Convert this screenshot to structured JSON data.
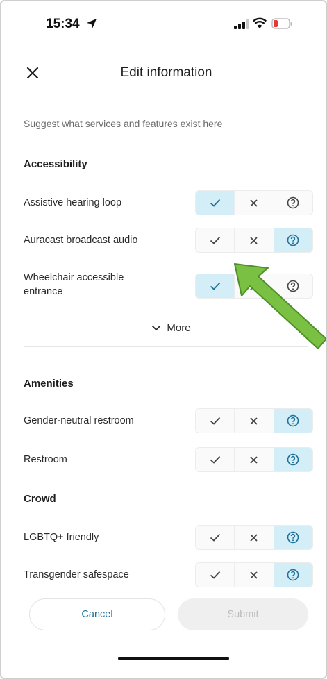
{
  "status_bar": {
    "time": "15:34"
  },
  "header": {
    "title": "Edit information"
  },
  "subtitle": "Suggest what services and features exist here",
  "sections": [
    {
      "title": "Accessibility",
      "items": [
        {
          "label": "Assistive hearing loop",
          "selected": "yes"
        },
        {
          "label": "Auracast broadcast audio",
          "selected": "unknown"
        },
        {
          "label": "Wheelchair accessible entrance",
          "selected": "yes"
        }
      ]
    },
    {
      "title": "Amenities",
      "items": [
        {
          "label": "Gender-neutral restroom",
          "selected": "unknown"
        },
        {
          "label": "Restroom",
          "selected": "unknown"
        }
      ]
    },
    {
      "title": "Crowd",
      "items": [
        {
          "label": "LGBTQ+ friendly",
          "selected": "unknown"
        },
        {
          "label": "Transgender safespace",
          "selected": "unknown"
        }
      ]
    }
  ],
  "more_label": "More",
  "footer": {
    "cancel_label": "Cancel",
    "submit_label": "Submit"
  },
  "colors": {
    "selected_bg": "#d4eef8",
    "selected_fg": "#1f6f97",
    "annotation_arrow": "#7ac143"
  }
}
